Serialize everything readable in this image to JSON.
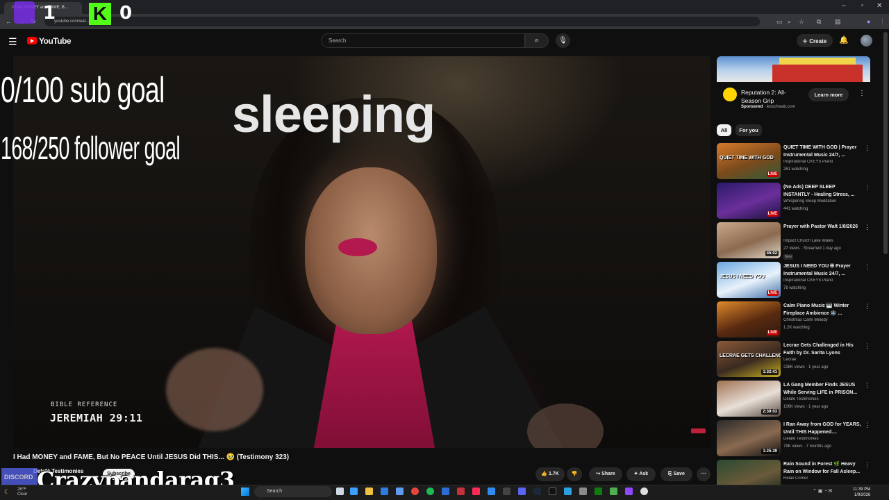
{
  "browser": {
    "tab_title": "I Had MONEY and FAME, B...",
    "url": "youtube.com/wat...",
    "window_controls": [
      "–",
      "▫",
      "✕"
    ]
  },
  "overlay": {
    "twitch_count": "1",
    "kick_count": "0",
    "kick_letter": "K",
    "sub_goal": "0/100 sub goal",
    "follower_goal": "168/250 follower goal",
    "status": "sleeping",
    "streamer_name": "Crazypandarag3",
    "discord_label": "DISCORD"
  },
  "header": {
    "wordmark": "YouTube",
    "search_placeholder": "Search",
    "create_label": "Create"
  },
  "video": {
    "bible_label": "BIBLE REFERENCE",
    "bible_ref": "JEREMIAH 29:11",
    "title": "I Had MONEY and FAME, But No PEACE Until JESUS Did THIS... 🥹 (Testimony 323)",
    "channel": "Delafé Testimonies",
    "subscribe_label": "Subscribe",
    "likes": "1.7K",
    "share_label": "Share",
    "ask_label": "Ask",
    "save_label": "Save"
  },
  "ad": {
    "title": "Reputation 2: All-Season Grip",
    "sponsored": "Sponsored",
    "domain": "lesschwab.com",
    "cta": "Learn more"
  },
  "chips": [
    "All",
    "For you"
  ],
  "recommended": [
    {
      "title": "QUIET TIME WITH GOD | Prayer Instrumental Music 24/7, ...",
      "channel": "Inspirational CKEYS Piano",
      "meta": "261 watching",
      "badge": "LIVE",
      "live": true,
      "thumb_colors": [
        "#d77a2a",
        "#7a4a1c",
        "#2f5a3a"
      ],
      "thumb_text": "QUIET TIME WITH GOD"
    },
    {
      "title": "(No Ads) DEEP SLEEP INSTANTLY - Healing Stress, ...",
      "channel": "Whispering Sleep Meditation",
      "meta": "441 watching",
      "badge": "LIVE",
      "live": true,
      "thumb_colors": [
        "#2a1a6a",
        "#6b2f9a",
        "#1a1240"
      ],
      "thumb_text": ""
    },
    {
      "title": "Prayer with Pastor Walt 1/8/2026",
      "channel": "Impact Church Lake Wales",
      "meta": "27 views · Streamed 1 day ago",
      "badge": "45:02",
      "live": false,
      "new": "New",
      "thumb_colors": [
        "#c9a98a",
        "#8b6a50",
        "#e0d6c8"
      ],
      "thumb_text": ""
    },
    {
      "title": "JESUS I NEED YOU ✠ Prayer Instrumental Music 24/7, ...",
      "channel": "Inspirational CKEYS Piano",
      "meta": "78 watching",
      "badge": "LIVE",
      "live": true,
      "thumb_colors": [
        "#6aa7e0",
        "#e8f2fb",
        "#3d6ea8"
      ],
      "thumb_text": "JESUS I NEED YOU"
    },
    {
      "title": "Calm Piano Music 🎹 Winter Fireplace Ambience ❄️ ...",
      "channel": "Christmas Calm Melody",
      "meta": "1.2K watching",
      "badge": "LIVE",
      "live": true,
      "thumb_colors": [
        "#e08a2a",
        "#5a2a10",
        "#2a1a10"
      ],
      "thumb_text": ""
    },
    {
      "title": "Lecrae Gets Challenged in His Faith by Dr. Sarita Lyons",
      "channel": "Lecrae",
      "meta": "238K views · 1 year ago",
      "badge": "1:32:41",
      "live": false,
      "thumb_colors": [
        "#8a5a3a",
        "#3a2a20",
        "#c8b020"
      ],
      "thumb_text": "LECRAE GETS CHALLENGED"
    },
    {
      "title": "LA Gang Member Finds JESUS While Serving LIFE in PRISON...",
      "channel": "Delafé Testimonies",
      "meta": "106K views · 1 year ago",
      "badge": "2:39:03",
      "live": false,
      "thumb_colors": [
        "#a07050",
        "#e8e0d8",
        "#5a4a40"
      ],
      "thumb_text": ""
    },
    {
      "title": "I Ran Away from GOD for YEARS, Until THIS Happened....",
      "channel": "Delafé Testimonies",
      "meta": "79K views · 7 months ago",
      "badge": "1:25:39",
      "live": false,
      "thumb_colors": [
        "#2a2a2a",
        "#8a6a50",
        "#101010"
      ],
      "thumb_text": ""
    },
    {
      "title": "Rain Sound in Forest 🌿 Heavy Rain on Window for Fall Asleep...",
      "channel": "Relax Corner",
      "meta": "",
      "badge": "",
      "live": false,
      "thumb_colors": [
        "#2a4a30",
        "#6a5a3a",
        "#10201a"
      ],
      "thumb_text": ""
    }
  ],
  "taskbar": {
    "weather_temp": "26°F",
    "weather_desc": "Clear",
    "search_label": "Search",
    "time": "11:39 PM",
    "date": "1/9/2026"
  }
}
